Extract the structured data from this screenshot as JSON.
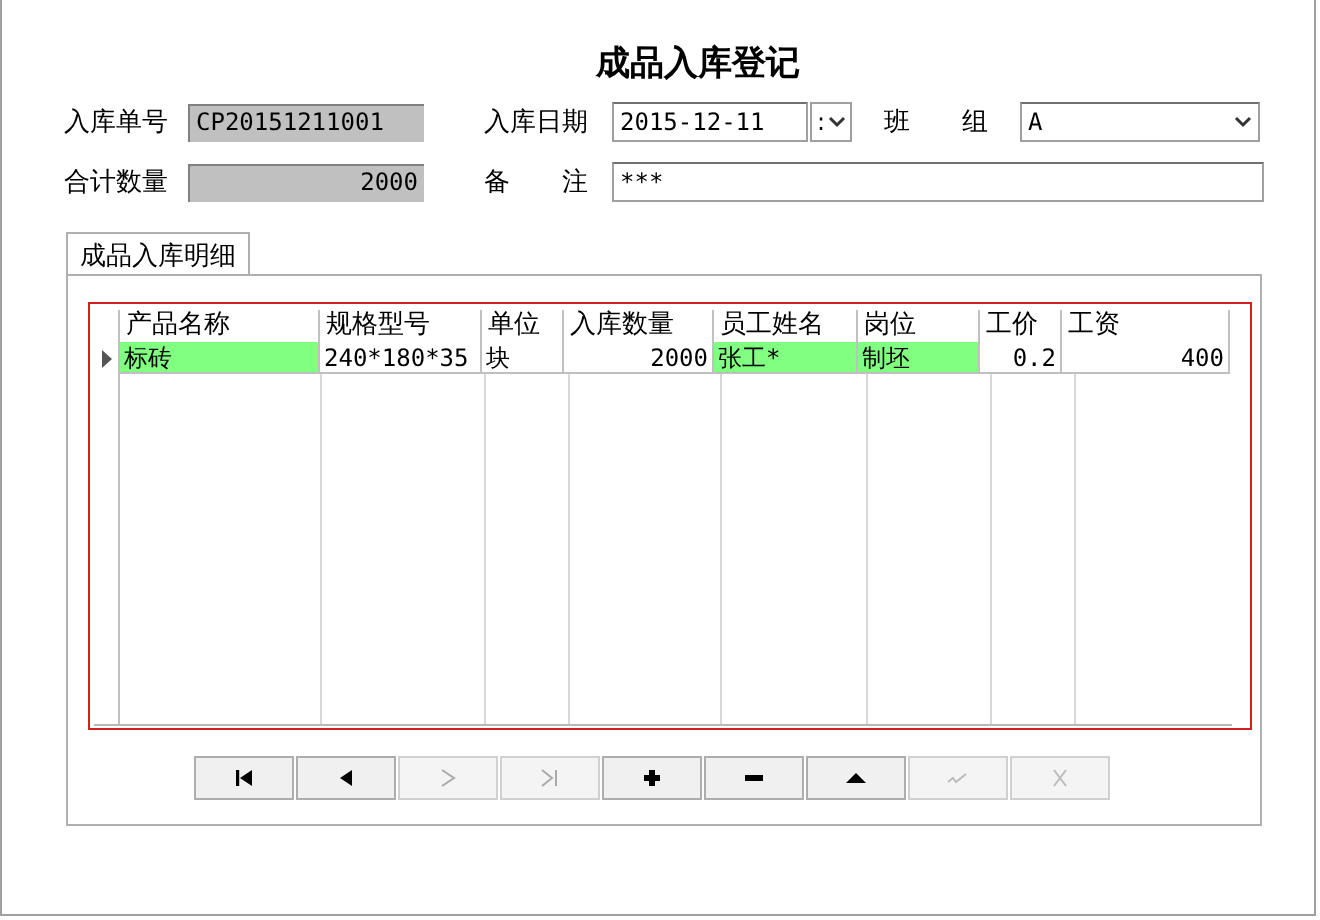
{
  "window": {
    "title": "成品入库登记"
  },
  "fields": [
    {
      "label": "入库单号",
      "kind": "readonly",
      "value": "CP20151211001"
    },
    {
      "label": "入库日期",
      "kind": "date",
      "value": "2015-12-11",
      "spin": ":"
    },
    {
      "label": "班　　组",
      "kind": "select",
      "value": "A"
    },
    {
      "label": "合计数量",
      "kind": "readonly-number",
      "value": "2000"
    },
    {
      "label": "备　　注",
      "kind": "text",
      "value": "***"
    }
  ],
  "tabs": [
    {
      "label": "成品入库明细",
      "selected": true
    }
  ],
  "table": {
    "columns": [
      {
        "label": "产品名称",
        "kind": "text"
      },
      {
        "label": "规格型号",
        "kind": "text"
      },
      {
        "label": "单位",
        "kind": "text"
      },
      {
        "label": "入库数量",
        "kind": "number"
      },
      {
        "label": "员工姓名",
        "kind": "text"
      },
      {
        "label": "岗位",
        "kind": "text"
      },
      {
        "label": "工价",
        "kind": "number"
      },
      {
        "label": "工资",
        "kind": "number"
      }
    ],
    "rows": [
      {
        "current": true,
        "cells": [
          {
            "text": "标砖",
            "highlighted": true
          },
          {
            "text": "240*180*35",
            "highlighted": false
          },
          {
            "text": "块",
            "highlighted": false
          },
          {
            "text": "2000",
            "highlighted": false
          },
          {
            "text": "张工*",
            "highlighted": true
          },
          {
            "text": "制坯",
            "highlighted": true
          },
          {
            "text": "0.2",
            "highlighted": false
          },
          {
            "text": "400",
            "highlighted": false
          }
        ]
      }
    ]
  },
  "navigator": [
    {
      "kind": "first",
      "disabled": false
    },
    {
      "kind": "prior",
      "disabled": false
    },
    {
      "kind": "next",
      "disabled": true
    },
    {
      "kind": "last",
      "disabled": true
    },
    {
      "kind": "insert",
      "disabled": false
    },
    {
      "kind": "delete",
      "disabled": false
    },
    {
      "kind": "edit",
      "disabled": false
    },
    {
      "kind": "post",
      "disabled": true
    },
    {
      "kind": "cancel",
      "disabled": true
    }
  ]
}
